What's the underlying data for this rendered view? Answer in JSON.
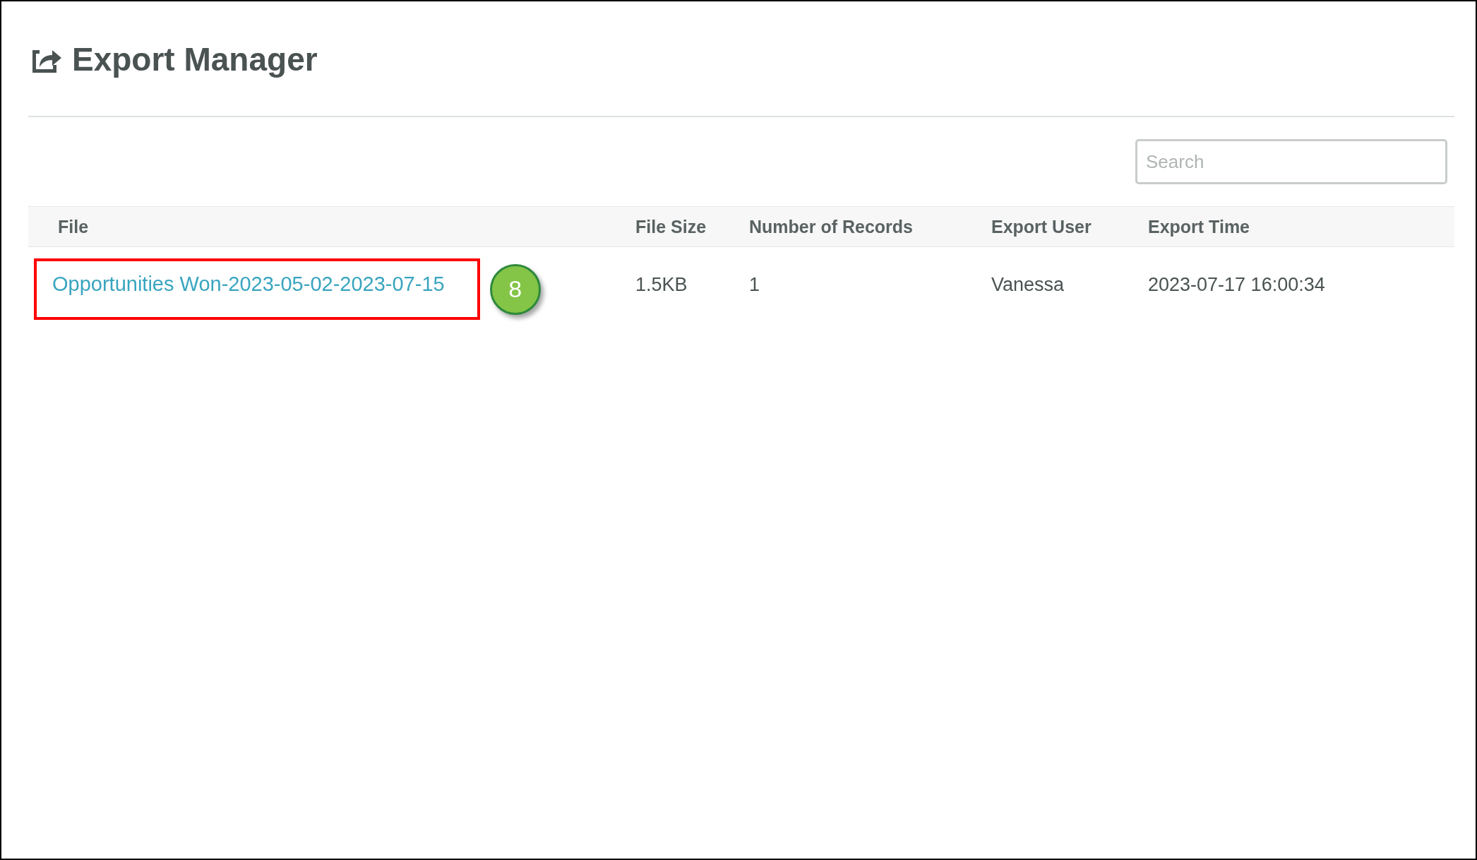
{
  "page": {
    "title": "Export Manager"
  },
  "search": {
    "placeholder": "Search"
  },
  "table": {
    "columns": [
      "File",
      "File Size",
      "Number of Records",
      "Export User",
      "Export Time"
    ],
    "rows": [
      {
        "file": "Opportunities Won-2023-05-02-2023-07-15",
        "highlighted": true,
        "callout": "8",
        "file_size": "1.5KB",
        "records": "1",
        "user": "Vanessa",
        "time": "2023-07-17 16:00:34"
      }
    ]
  }
}
